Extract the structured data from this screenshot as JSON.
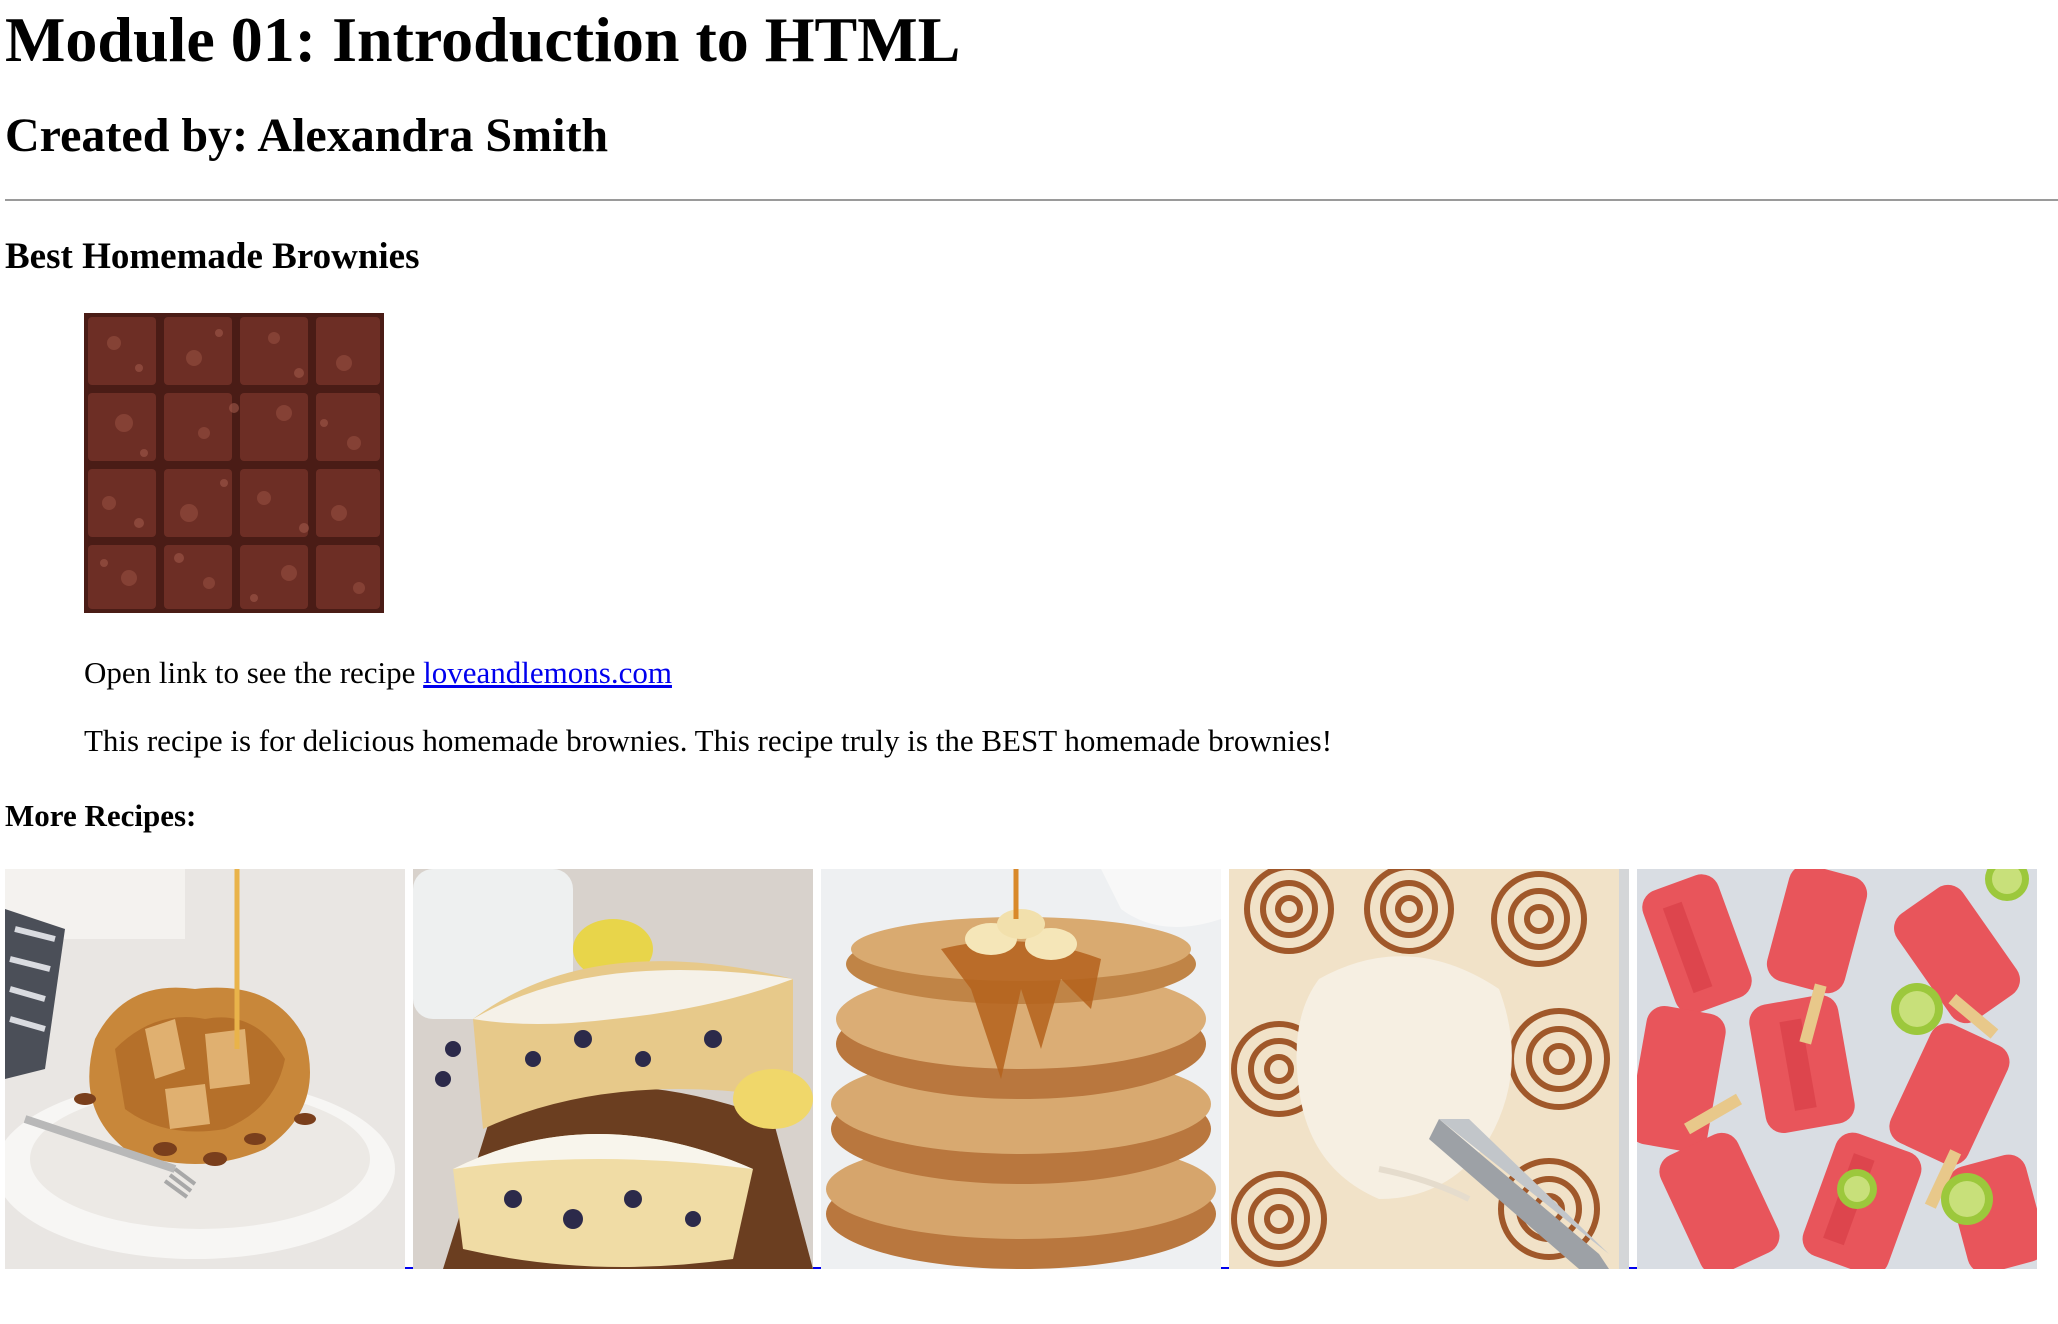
{
  "header": {
    "title": "Module 01: Introduction to HTML",
    "author": "Created by: Alexandra Smith"
  },
  "recipe": {
    "title": "Best Homemade Brownies",
    "image_icon": "brownie-photo",
    "link_prefix": "Open link to see the recipe ",
    "link_text": "loveandlemons.com",
    "description": "This recipe is for delicious homemade brownies. This recipe truly is the BEST homemade brownies!"
  },
  "more": {
    "heading": "More Recipes:",
    "items": [
      {
        "icon": "french-toast-bake-photo"
      },
      {
        "icon": "blueberry-lemon-bread-photo"
      },
      {
        "icon": "pancake-stack-photo"
      },
      {
        "icon": "cinnamon-rolls-photo"
      },
      {
        "icon": "watermelon-popsicles-photo"
      }
    ]
  }
}
